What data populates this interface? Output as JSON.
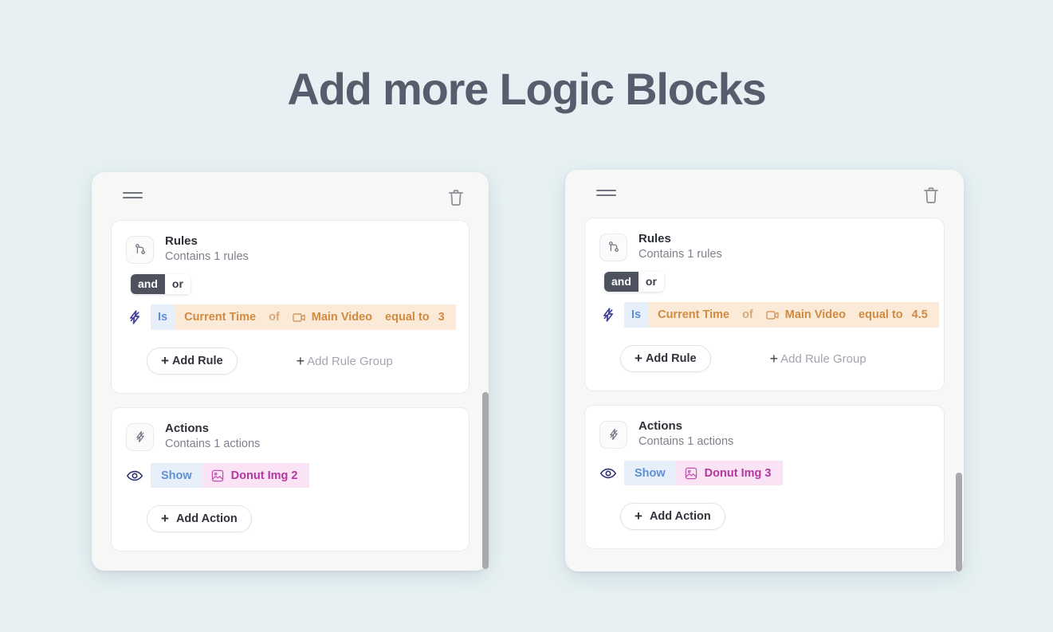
{
  "page": {
    "title": "Add more Logic Blocks",
    "background_color": "#e7f1f3",
    "title_color": "#565e6e"
  },
  "icons": {
    "drag": "drag-handle-icon",
    "trash": "trash-icon",
    "rules": "git-branch-icon",
    "actions": "lightning-bolt-icon",
    "rule_bolt": "lightning-bolt-icon",
    "video": "video-camera-icon",
    "eye": "eye-icon",
    "image": "image-icon"
  },
  "colors": {
    "accent_orange": "#cf8b3f",
    "chip_orange_bg": "#fcead9",
    "accent_blue": "#5d8fd6",
    "chip_blue_bg": "#e7effb",
    "accent_magenta": "#b4379f",
    "chip_magenta_bg": "#fae3f5",
    "toggle_on_bg": "#4e525f"
  },
  "blocks": [
    {
      "id": "logic-block-1",
      "rules": {
        "title": "Rules",
        "subtitle": "Contains 1 rules",
        "toggle": {
          "and": "and",
          "or": "or",
          "selected": "and"
        },
        "rule": {
          "is": "Is",
          "property": "Current Time",
          "of": "of",
          "target": "Main Video",
          "operator": "equal to",
          "value": "3"
        },
        "add_rule": "Add Rule",
        "add_rule_group": "Add Rule Group",
        "plus": "+"
      },
      "actions": {
        "title": "Actions",
        "subtitle": "Contains 1 actions",
        "action": {
          "verb": "Show",
          "target": "Donut Img 2"
        },
        "add_action": "Add Action",
        "plus": "+"
      }
    },
    {
      "id": "logic-block-2",
      "rules": {
        "title": "Rules",
        "subtitle": "Contains 1 rules",
        "toggle": {
          "and": "and",
          "or": "or",
          "selected": "and"
        },
        "rule": {
          "is": "Is",
          "property": "Current Time",
          "of": "of",
          "target": "Main Video",
          "operator": "equal to",
          "value": "4.5"
        },
        "add_rule": "Add Rule",
        "add_rule_group": "Add Rule Group",
        "plus": "+"
      },
      "actions": {
        "title": "Actions",
        "subtitle": "Contains 1 actions",
        "action": {
          "verb": "Show",
          "target": "Donut Img 3"
        },
        "add_action": "Add Action",
        "plus": "+"
      }
    }
  ]
}
